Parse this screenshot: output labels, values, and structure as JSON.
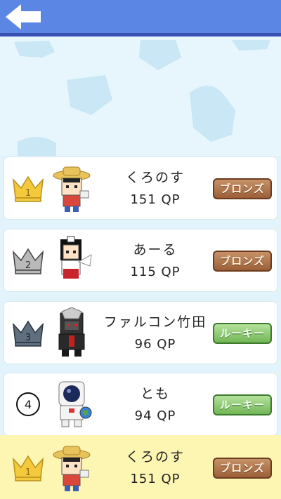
{
  "header": {
    "back_icon": "back-arrow-icon",
    "color": "#5b86e3"
  },
  "ranking": [
    {
      "rank": "1",
      "rank_icon": "gold-crown-icon",
      "name": "くろのす",
      "points": "151 QP",
      "badge": "ブロンズ",
      "badge_type": "bronze",
      "avatar_icon": "straw-hat-character-avatar"
    },
    {
      "rank": "2",
      "rank_icon": "silver-crown-icon",
      "name": "あーる",
      "points": "115 QP",
      "badge": "ブロンズ",
      "badge_type": "bronze",
      "avatar_icon": "shrine-maiden-character-avatar"
    },
    {
      "rank": "3",
      "rank_icon": "bronze-crown-icon",
      "name": "ファルコン竹田",
      "points": "96 QP",
      "badge": "ルーキー",
      "badge_type": "rookie",
      "avatar_icon": "armored-character-avatar"
    },
    {
      "rank": "4",
      "rank_icon": "circle-number-icon",
      "name": "とも",
      "points": "94 QP",
      "badge": "ルーキー",
      "badge_type": "rookie",
      "avatar_icon": "astronaut-character-avatar"
    }
  ],
  "my_rank": {
    "rank": "1",
    "rank_icon": "gold-crown-icon",
    "name": "くろのす",
    "points": "151 QP",
    "badge": "ブロンズ",
    "badge_type": "bronze",
    "avatar_icon": "straw-hat-character-avatar"
  },
  "colors": {
    "bronze": "#9c5f37",
    "rookie": "#71b656",
    "footer_bg": "#fdf6b2"
  }
}
